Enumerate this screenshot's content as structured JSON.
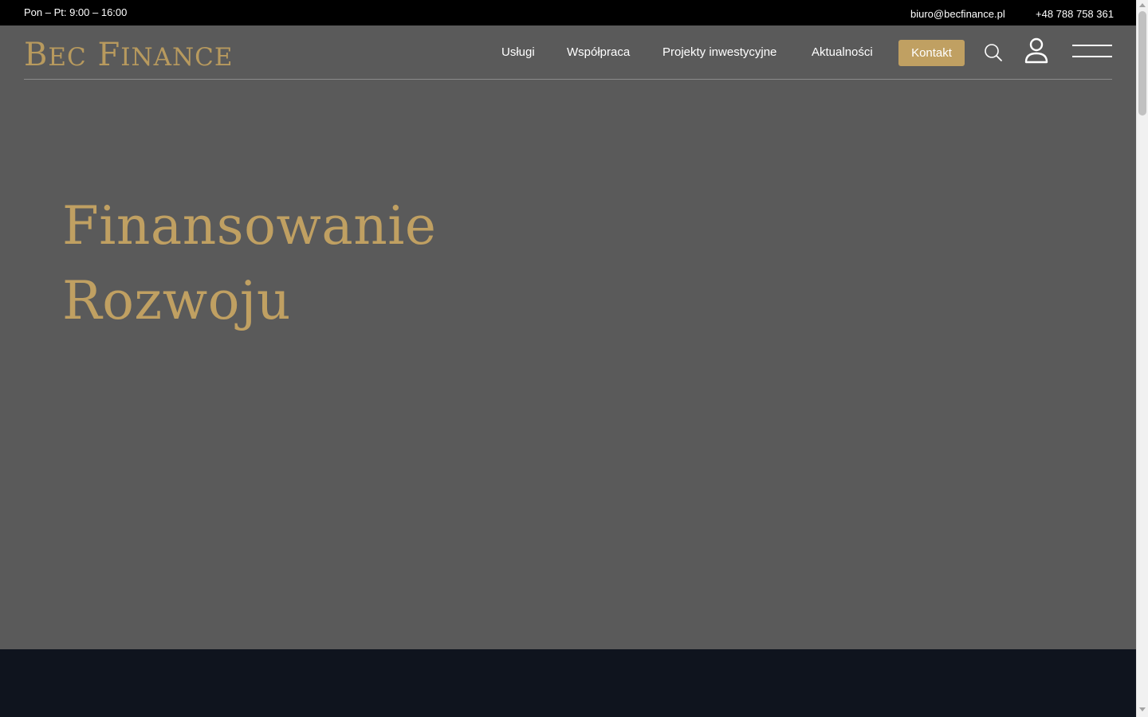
{
  "topbar": {
    "hours": "Pon – Pt: 9:00 – 16:00",
    "email": "biuro@becfinance.pl",
    "phone": "+48 788 758 361"
  },
  "header": {
    "logo_initial_b": "B",
    "logo_rest_ec": "EC",
    "logo_initial_f": "F",
    "logo_rest_inance": "INANCE",
    "nav": [
      {
        "label": "Usługi"
      },
      {
        "label": "Współpraca"
      },
      {
        "label": "Projekty inwestycyjne"
      },
      {
        "label": "Aktualności"
      }
    ],
    "cta_label": "Kontakt",
    "icons": [
      "search-icon",
      "user-icon",
      "menu-icon"
    ]
  },
  "hero": {
    "title_line1": "Finansowanie",
    "title_line2": "Rozwoju"
  },
  "colors": {
    "accent": "#c0a062",
    "hero_bg": "#5a5a5a",
    "topbar_bg": "#000000",
    "footer_bg": "#0f141e"
  }
}
